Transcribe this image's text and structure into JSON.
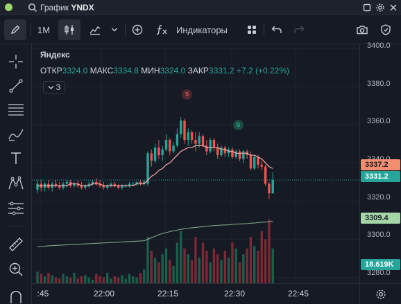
{
  "titlebar": {
    "prefix": "График",
    "symbol": "YNDX"
  },
  "toolbar": {
    "interval": "1M",
    "indicators": "Индикаторы"
  },
  "legend": {
    "name": "Яндекс",
    "open_label": "ОТКР",
    "open": "3324.0",
    "high_label": "МАКС",
    "high": "3334.8",
    "low_label": "МИН",
    "low": "3324.0",
    "close_label": "ЗАКР",
    "close": "3331.2",
    "change": "+7.2 (+0.22%)",
    "collapse_count": "3"
  },
  "markers": {
    "sell": "S",
    "buy": "B"
  },
  "price_scale": {
    "ticks": [
      "3400.0",
      "3380.0",
      "3360.0",
      "3340.0",
      "3320.0",
      "3300.0",
      "3280.0"
    ],
    "badge_ma": "3337.2",
    "badge_last": "3331.2",
    "badge_slow": "3309.4",
    "badge_volume": "18.619K"
  },
  "time_scale": {
    "ticks": [
      ":45",
      "22:00",
      "22:15",
      "22:30",
      "22:45"
    ]
  },
  "colors": {
    "up": "#26a69a",
    "down": "#ef5350",
    "vol_up": "#1b5e4a",
    "vol_down": "#7b2a33",
    "ma_line": "#f7a9a8",
    "slow_line": "#a5d6a7",
    "badge_ma": "#f28e6e",
    "badge_last": "#26a69a",
    "badge_slow": "#a5d6a7"
  },
  "chart_data": {
    "type": "candlestick",
    "price_range": [
      3277,
      3402
    ],
    "ohlc": [
      {
        "o": 3326,
        "h": 3331,
        "l": 3324,
        "c": 3329
      },
      {
        "o": 3329,
        "h": 3331,
        "l": 3325,
        "c": 3327
      },
      {
        "o": 3327,
        "h": 3330,
        "l": 3325,
        "c": 3329
      },
      {
        "o": 3329,
        "h": 3331,
        "l": 3326,
        "c": 3327
      },
      {
        "o": 3327,
        "h": 3330,
        "l": 3325,
        "c": 3329
      },
      {
        "o": 3329,
        "h": 3331,
        "l": 3327,
        "c": 3328
      },
      {
        "o": 3328,
        "h": 3330,
        "l": 3326,
        "c": 3327
      },
      {
        "o": 3327,
        "h": 3330,
        "l": 3326,
        "c": 3329
      },
      {
        "o": 3329,
        "h": 3331,
        "l": 3327,
        "c": 3330
      },
      {
        "o": 3330,
        "h": 3331,
        "l": 3327,
        "c": 3328
      },
      {
        "o": 3328,
        "h": 3330,
        "l": 3327,
        "c": 3329
      },
      {
        "o": 3329,
        "h": 3331,
        "l": 3327,
        "c": 3328
      },
      {
        "o": 3328,
        "h": 3330,
        "l": 3326,
        "c": 3327
      },
      {
        "o": 3327,
        "h": 3329,
        "l": 3326,
        "c": 3328
      },
      {
        "o": 3328,
        "h": 3330,
        "l": 3327,
        "c": 3329
      },
      {
        "o": 3329,
        "h": 3331,
        "l": 3328,
        "c": 3330
      },
      {
        "o": 3330,
        "h": 3332,
        "l": 3328,
        "c": 3329
      },
      {
        "o": 3329,
        "h": 3331,
        "l": 3327,
        "c": 3328
      },
      {
        "o": 3328,
        "h": 3330,
        "l": 3326,
        "c": 3327
      },
      {
        "o": 3327,
        "h": 3329,
        "l": 3326,
        "c": 3328
      },
      {
        "o": 3328,
        "h": 3330,
        "l": 3327,
        "c": 3329
      },
      {
        "o": 3329,
        "h": 3330,
        "l": 3327,
        "c": 3328
      },
      {
        "o": 3328,
        "h": 3329,
        "l": 3326,
        "c": 3327
      },
      {
        "o": 3327,
        "h": 3329,
        "l": 3326,
        "c": 3328
      },
      {
        "o": 3328,
        "h": 3329,
        "l": 3327,
        "c": 3328
      },
      {
        "o": 3328,
        "h": 3330,
        "l": 3327,
        "c": 3329
      },
      {
        "o": 3329,
        "h": 3330,
        "l": 3328,
        "c": 3329
      },
      {
        "o": 3329,
        "h": 3330,
        "l": 3328,
        "c": 3330
      },
      {
        "o": 3330,
        "h": 3331,
        "l": 3328,
        "c": 3329
      },
      {
        "o": 3329,
        "h": 3331,
        "l": 3328,
        "c": 3330
      },
      {
        "o": 3329,
        "h": 3346,
        "l": 3328,
        "c": 3345
      },
      {
        "o": 3345,
        "h": 3347,
        "l": 3338,
        "c": 3341
      },
      {
        "o": 3341,
        "h": 3350,
        "l": 3340,
        "c": 3348
      },
      {
        "o": 3348,
        "h": 3352,
        "l": 3342,
        "c": 3344
      },
      {
        "o": 3344,
        "h": 3349,
        "l": 3341,
        "c": 3347
      },
      {
        "o": 3347,
        "h": 3355,
        "l": 3346,
        "c": 3352
      },
      {
        "o": 3352,
        "h": 3353,
        "l": 3344,
        "c": 3346
      },
      {
        "o": 3346,
        "h": 3351,
        "l": 3345,
        "c": 3349
      },
      {
        "o": 3349,
        "h": 3358,
        "l": 3348,
        "c": 3355
      },
      {
        "o": 3355,
        "h": 3364,
        "l": 3353,
        "c": 3362
      },
      {
        "o": 3362,
        "h": 3363,
        "l": 3350,
        "c": 3352
      },
      {
        "o": 3352,
        "h": 3358,
        "l": 3349,
        "c": 3356
      },
      {
        "o": 3356,
        "h": 3357,
        "l": 3350,
        "c": 3352
      },
      {
        "o": 3352,
        "h": 3356,
        "l": 3346,
        "c": 3350
      },
      {
        "o": 3350,
        "h": 3356,
        "l": 3348,
        "c": 3354
      },
      {
        "o": 3354,
        "h": 3355,
        "l": 3348,
        "c": 3349
      },
      {
        "o": 3349,
        "h": 3352,
        "l": 3344,
        "c": 3346
      },
      {
        "o": 3346,
        "h": 3353,
        "l": 3345,
        "c": 3352
      },
      {
        "o": 3352,
        "h": 3353,
        "l": 3346,
        "c": 3348
      },
      {
        "o": 3348,
        "h": 3350,
        "l": 3342,
        "c": 3344
      },
      {
        "o": 3344,
        "h": 3349,
        "l": 3343,
        "c": 3348
      },
      {
        "o": 3348,
        "h": 3349,
        "l": 3343,
        "c": 3345
      },
      {
        "o": 3345,
        "h": 3348,
        "l": 3343,
        "c": 3347
      },
      {
        "o": 3347,
        "h": 3348,
        "l": 3342,
        "c": 3343
      },
      {
        "o": 3343,
        "h": 3347,
        "l": 3342,
        "c": 3346
      },
      {
        "o": 3346,
        "h": 3347,
        "l": 3341,
        "c": 3342
      },
      {
        "o": 3342,
        "h": 3347,
        "l": 3340,
        "c": 3346
      },
      {
        "o": 3346,
        "h": 3347,
        "l": 3342,
        "c": 3344
      },
      {
        "o": 3344,
        "h": 3346,
        "l": 3336,
        "c": 3337
      },
      {
        "o": 3337,
        "h": 3344,
        "l": 3336,
        "c": 3343
      },
      {
        "o": 3343,
        "h": 3344,
        "l": 3337,
        "c": 3339
      },
      {
        "o": 3339,
        "h": 3341,
        "l": 3336,
        "c": 3338
      },
      {
        "o": 3338,
        "h": 3339,
        "l": 3328,
        "c": 3329
      },
      {
        "o": 3329,
        "h": 3330,
        "l": 3321,
        "c": 3324
      },
      {
        "o": 3324,
        "h": 3335,
        "l": 3324,
        "c": 3331
      }
    ],
    "volume": [
      10,
      8,
      6,
      9,
      7,
      5,
      4,
      8,
      6,
      5,
      9,
      4,
      6,
      7,
      5,
      3,
      8,
      6,
      5,
      9,
      4,
      6,
      5,
      7,
      4,
      8,
      6,
      5,
      9,
      12,
      40,
      28,
      22,
      18,
      25,
      30,
      20,
      15,
      35,
      45,
      30,
      25,
      20,
      40,
      22,
      35,
      28,
      18,
      30,
      25,
      20,
      28,
      22,
      35,
      30,
      18,
      25,
      30,
      40,
      32,
      28,
      45,
      38,
      55,
      30
    ],
    "ma": [
      3328,
      3328,
      3328,
      3328,
      3328,
      3328,
      3328,
      3328,
      3328,
      3329,
      3329,
      3329,
      3328,
      3328,
      3328,
      3329,
      3329,
      3329,
      3328,
      3328,
      3328,
      3328,
      3328,
      3328,
      3328,
      3328,
      3328,
      3329,
      3329,
      3329,
      3331,
      3333,
      3334,
      3336,
      3337,
      3339,
      3340,
      3342,
      3344,
      3346,
      3347,
      3348,
      3348,
      3349,
      3349,
      3349,
      3348,
      3348,
      3348,
      3348,
      3347,
      3347,
      3346,
      3346,
      3345,
      3345,
      3345,
      3345,
      3344,
      3344,
      3343,
      3342,
      3340,
      3338,
      3337
    ],
    "slow_ma": [
      3296,
      3296.2,
      3296.4,
      3296.6,
      3296.7,
      3296.8,
      3296.9,
      3297,
      3297.1,
      3297.2,
      3297.3,
      3297.4,
      3297.5,
      3297.6,
      3297.7,
      3297.8,
      3297.9,
      3298,
      3298.1,
      3298.2,
      3298.3,
      3298.4,
      3298.5,
      3298.6,
      3298.7,
      3298.8,
      3298.9,
      3299,
      3299.1,
      3299.2,
      3300,
      3300.8,
      3301.6,
      3302.4,
      3303,
      3303.5,
      3304,
      3304.4,
      3304.8,
      3305.2,
      3305.5,
      3305.8,
      3306,
      3306.2,
      3306.4,
      3306.6,
      3306.8,
      3307,
      3307.2,
      3307.3,
      3307.4,
      3307.5,
      3307.6,
      3307.8,
      3307.9,
      3308,
      3308.1,
      3308.2,
      3308.4,
      3308.5,
      3308.7,
      3308.9,
      3309,
      3309.2,
      3309.4
    ]
  }
}
